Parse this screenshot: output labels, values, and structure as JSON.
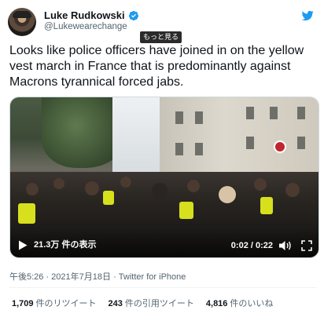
{
  "user": {
    "display_name": "Luke Rudkowski",
    "handle": "@Lukewearechange"
  },
  "tooltip": "もっと見る",
  "tweet": {
    "text": "Looks like police officers have joined in on the yellow vest march in France that is predominantly against Macrons tyrannical forced jabs."
  },
  "video": {
    "views": "21.3万 件の表示",
    "time": "0:02 / 0:22"
  },
  "meta": {
    "timestamp": "午後5:26 · 2021年7月18日",
    "separator": " · ",
    "source": "Twitter for iPhone"
  },
  "stats": {
    "retweets_count": "1,709",
    "retweets_label": "件のリツイート",
    "quotes_count": "243",
    "quotes_label": "件の引用ツイート",
    "likes_count": "4,816",
    "likes_label": "件のいいね"
  },
  "colors": {
    "verified": "#1d9bf0",
    "twitter_blue": "#1d9bf0",
    "text": "#0f1419",
    "secondary": "#536471"
  },
  "icons": [
    "verified-badge-icon",
    "twitter-bird-icon",
    "play-icon",
    "volume-icon",
    "fullscreen-icon"
  ]
}
